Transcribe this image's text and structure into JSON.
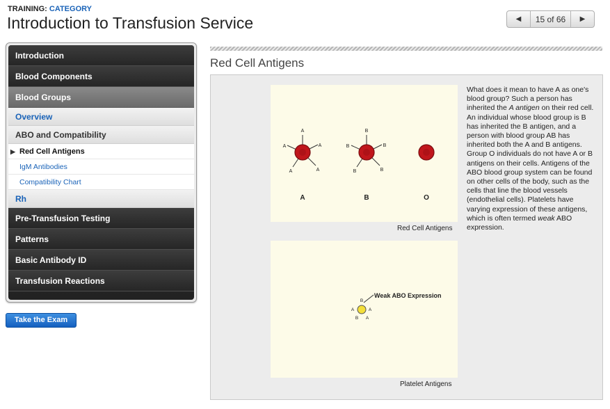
{
  "header": {
    "breadcrumb_prefix": "TRAINING:",
    "breadcrumb_category": "CATEGORY",
    "title": "Introduction to Transfusion Service"
  },
  "pager": {
    "prev_icon": "triangle-left-icon",
    "next_icon": "triangle-right-icon",
    "label": "15 of 66"
  },
  "sidebar": {
    "items_top": [
      {
        "label": "Introduction"
      },
      {
        "label": "Blood Components"
      },
      {
        "label": "Blood Groups"
      }
    ],
    "overview": "Overview",
    "abo": "ABO and Compatibility",
    "abo_children": [
      {
        "label": "Red Cell Antigens"
      },
      {
        "label": "IgM Antibodies"
      },
      {
        "label": "Compatibility Chart"
      }
    ],
    "rh": "Rh",
    "items_bottom": [
      {
        "label": "Pre-Transfusion Testing"
      },
      {
        "label": "Patterns"
      },
      {
        "label": "Basic Antibody ID"
      },
      {
        "label": "Transfusion Reactions"
      }
    ]
  },
  "exam_button": "Take the Exam",
  "content": {
    "section_title": "Red Cell Antigens",
    "fig1": {
      "caption": "Red Cell Antigens",
      "antigen_a": "A",
      "antigen_b": "B",
      "group_labels": [
        "A",
        "B",
        "O"
      ]
    },
    "fig2": {
      "caption": "Platelet Antigens",
      "annotation": "Weak ABO Expression",
      "antigen_a": "A",
      "antigen_b": "B"
    },
    "text": {
      "p1": "What does it mean to have A as one's blood group? Such a person has inherited the ",
      "em1": "A antigen",
      "p2": " on their red cell. An individual whose blood group is B has inherited the B antigen, and a person with blood group AB has inherited both the A and B antigens. Group O individuals do not have A or B antigens on their cells. Antigens of the ABO blood group system can be found on other cells of the body, such as the cells that line the blood vessels (endothelial cells). Platelets have varying expression of these antigens, which is often termed ",
      "em2": "weak",
      "p3": " ABO expression."
    }
  },
  "colors": {
    "accent_blue": "#1a63b8",
    "red_cell": "#c0161b",
    "platelet": "#f4df3a",
    "figure_bg": "#fdfbe8"
  }
}
